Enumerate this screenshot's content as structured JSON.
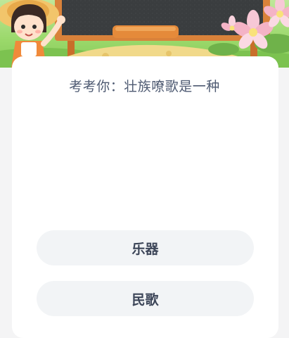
{
  "quiz": {
    "question": "考考你：壮族嘹歌是一种",
    "options": [
      {
        "label": "乐器"
      },
      {
        "label": "民歌"
      }
    ]
  },
  "colors": {
    "page_background": "#f4f4f5",
    "card_background": "#ffffff",
    "option_background": "#f2f4f6",
    "question_text": "#4e5a72",
    "option_text": "#3d4659",
    "chalkboard": "#3a3d3f",
    "board_frame": "#d9823a"
  },
  "banner": {
    "illustration": [
      "girl-mascot-illustration",
      "chalkboard-illustration",
      "flower-illustration"
    ]
  }
}
